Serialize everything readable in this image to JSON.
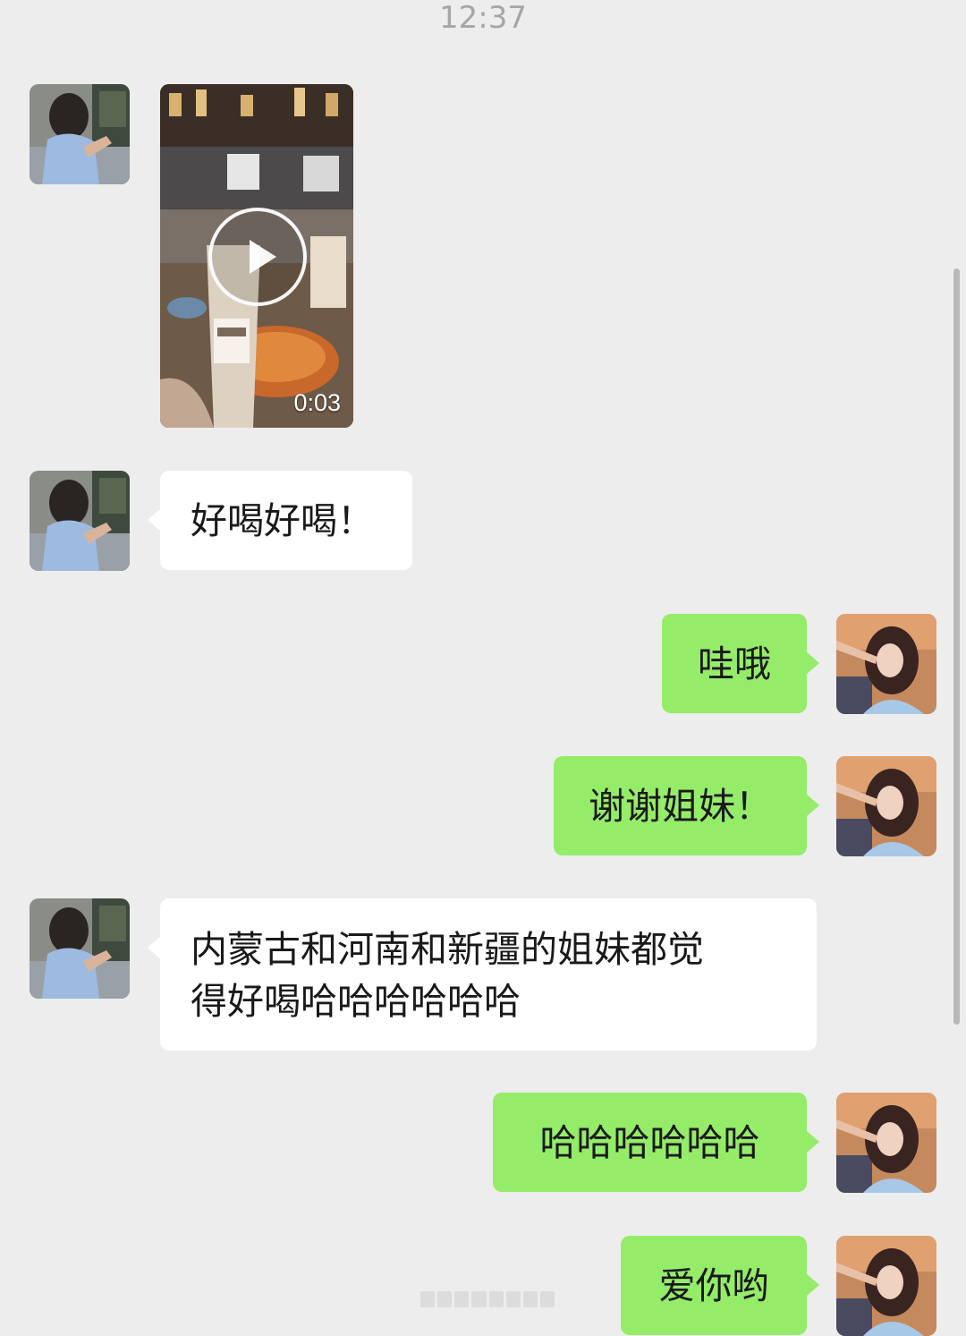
{
  "header": {
    "time": "12:37"
  },
  "messages": [
    {
      "side": "left",
      "type": "video",
      "duration": "0:03"
    },
    {
      "side": "left",
      "type": "text",
      "text": "好喝好喝！"
    },
    {
      "side": "right",
      "type": "text",
      "text": "哇哦"
    },
    {
      "side": "right",
      "type": "text",
      "text": "谢谢姐妹！"
    },
    {
      "side": "left",
      "type": "text",
      "text": "内蒙古和河南和新疆的姐妹都觉\n得好喝哈哈哈哈哈哈"
    },
    {
      "side": "right",
      "type": "text",
      "text": "哈哈哈哈哈哈"
    },
    {
      "side": "right",
      "type": "text",
      "text": "爱你哟"
    }
  ],
  "colors": {
    "background": "#ededed",
    "left_bubble": "#ffffff",
    "right_bubble": "#95ec69",
    "timestamp": "#a6a6a6"
  },
  "icons": {
    "play": "play-icon"
  }
}
